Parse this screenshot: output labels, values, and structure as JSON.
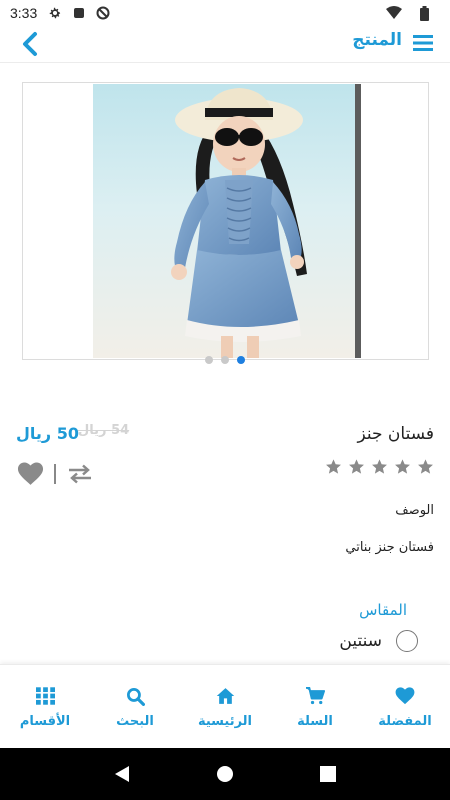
{
  "status_bar": {
    "time": "3:33",
    "icons": [
      "gear-icon",
      "stop-icon",
      "data-saver-icon",
      "wifi-icon",
      "battery-icon"
    ]
  },
  "app_bar": {
    "title": "المنتج",
    "back_icon": "chevron-left-icon",
    "menu_icon": "hamburger-menu-icon"
  },
  "carousel": {
    "image_alt": "طفلة ترتدي فستان جنز",
    "dot_count": 3,
    "active_dot": 3
  },
  "product": {
    "name": "فستان جنز",
    "price": "50 ريال",
    "old_price": "54 ريال",
    "rating": 0,
    "max_rating": 5,
    "description_label": "الوصف",
    "description": "فستان جنز بناتي",
    "size_label": "المقاس",
    "size_options": [
      "سنتين"
    ]
  },
  "bottom_nav": {
    "items": [
      {
        "label": "المفضلة",
        "icon": "heart-icon"
      },
      {
        "label": "السلة",
        "icon": "cart-icon"
      },
      {
        "label": "الرئيسية",
        "icon": "home-icon"
      },
      {
        "label": "البحث",
        "icon": "search-icon"
      },
      {
        "label": "الأقسام",
        "icon": "grid-icon"
      }
    ]
  },
  "colors": {
    "accent": "#1e9ad6",
    "active_dot": "#1e7fe0",
    "star": "#8a8a8a",
    "old_price": "#d4d4d4"
  }
}
